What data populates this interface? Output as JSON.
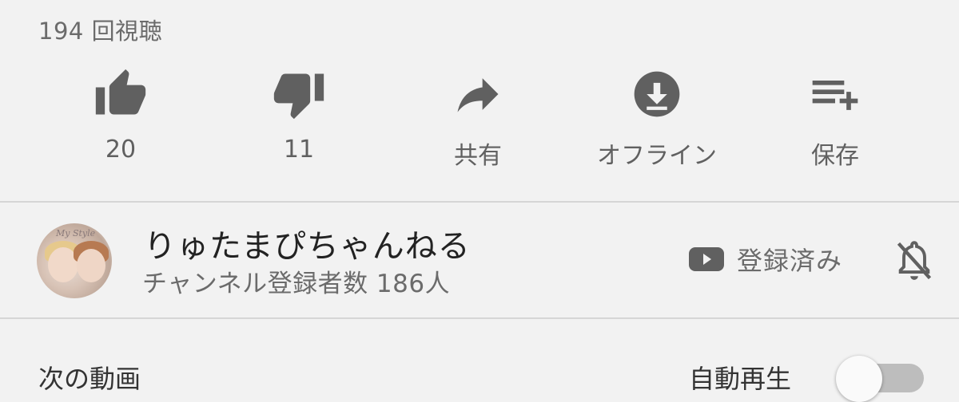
{
  "video": {
    "views": "194 回視聴"
  },
  "actions": [
    {
      "icon": "thumb-up-icon",
      "label": "20"
    },
    {
      "icon": "thumb-down-icon",
      "label": "11"
    },
    {
      "icon": "share-icon",
      "label": "共有"
    },
    {
      "icon": "download-icon",
      "label": "オフライン"
    },
    {
      "icon": "playlist-add-icon",
      "label": "保存"
    }
  ],
  "channel": {
    "avatar_text": "My Style",
    "name": "りゅたまぴちゃんねる",
    "subscribers": "チャンネル登録者数 186人",
    "subscribed_label": "登録済み",
    "subscribed_icon": "youtube-icon",
    "bell_icon": "bell-off-icon"
  },
  "up_next": {
    "label": "次の動画",
    "autoplay_label": "自動再生",
    "autoplay_on": false
  },
  "colors": {
    "background": "#f2f2f2",
    "icon": "#606060",
    "divider": "#d6d6d6"
  }
}
